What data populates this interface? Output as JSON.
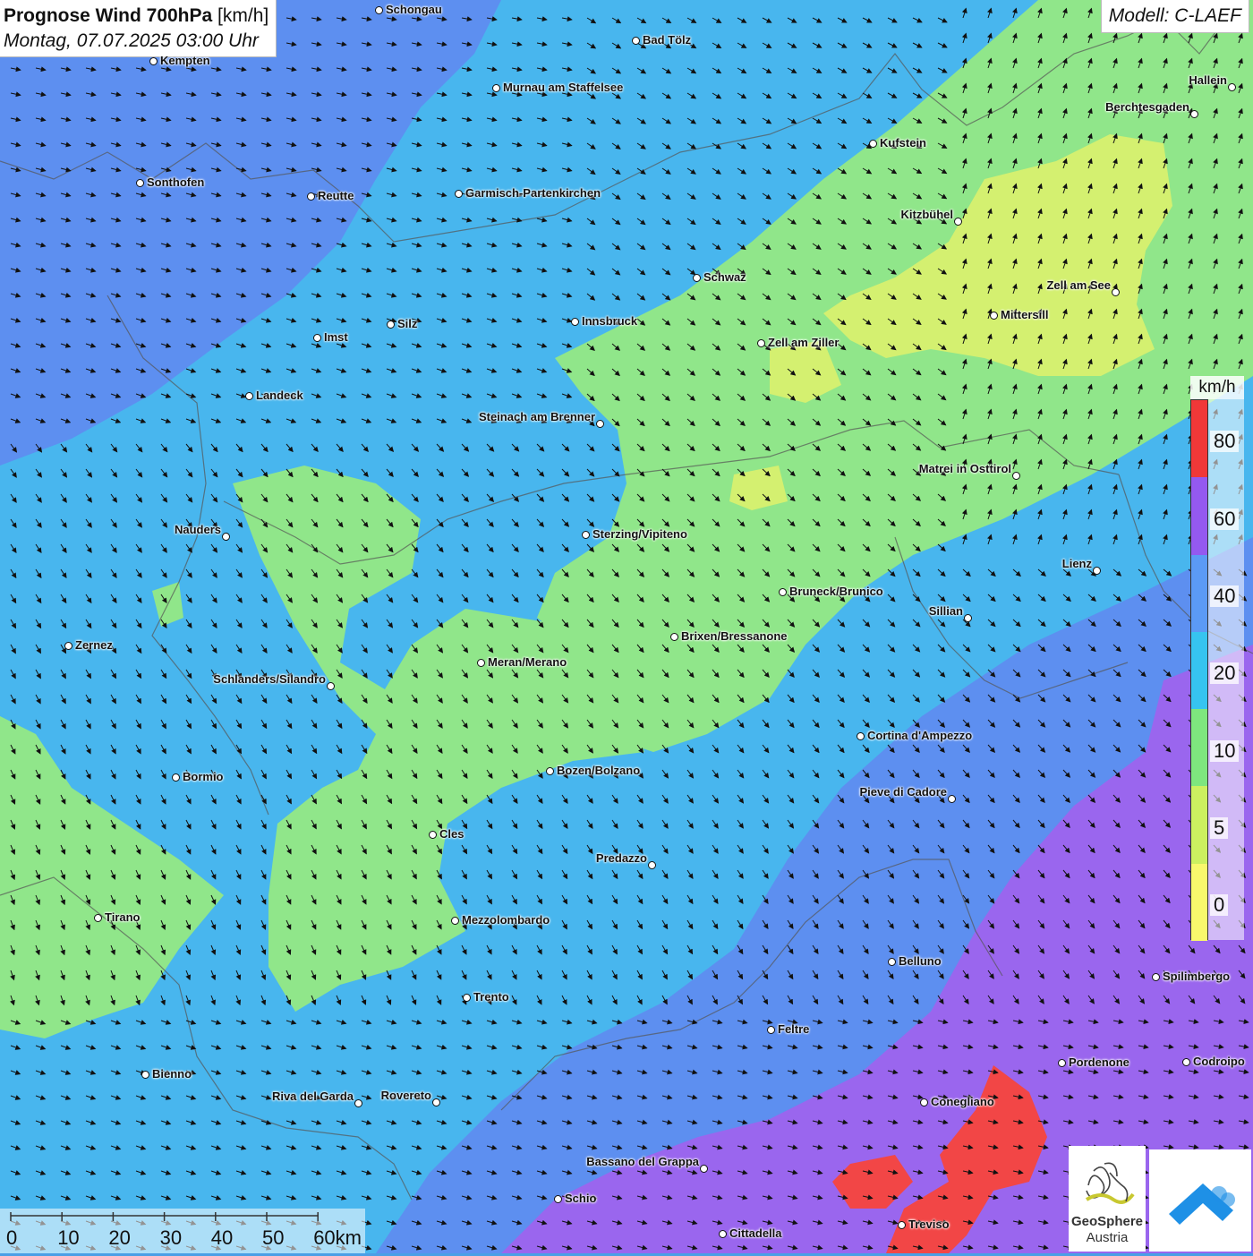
{
  "header": {
    "title_bold": "Prognose Wind 700hPa",
    "title_unit": "[km/h]",
    "subtitle": "Montag, 07.07.2025 03:00 Uhr"
  },
  "model": {
    "label": "Modell: C-LAEF"
  },
  "legend": {
    "unit": "km/h",
    "bands": [
      {
        "label": "80",
        "color": "#f03838"
      },
      {
        "label": "60",
        "color": "#9459f0"
      },
      {
        "label": "40",
        "color": "#5b9af5"
      },
      {
        "label": "20",
        "color": "#36c4f0"
      },
      {
        "label": "10",
        "color": "#7ee67e"
      },
      {
        "label": "5",
        "color": "#ccf060"
      },
      {
        "label": "0",
        "color": "#f8f86c"
      }
    ]
  },
  "scale_bar": {
    "labels": [
      "0",
      "10",
      "20",
      "30",
      "40",
      "50",
      "60km"
    ]
  },
  "logos": {
    "geosphere_line1": "GeoSphere",
    "geosphere_line2": "Austria"
  },
  "colors": {
    "purple_wind": "#9a66ee",
    "blue_wind": "#5d8ff0",
    "cyan_wind": "#48b6ee",
    "green_wind": "#90e68a",
    "yellowgreen_wind": "#d4f070",
    "red_wind": "#f24646"
  },
  "cities": [
    {
      "name": "Schongau"
    },
    {
      "name": "Bad Tölz"
    },
    {
      "name": "Kempten"
    },
    {
      "name": "Murnau am Staffelsee"
    },
    {
      "name": "Hallein"
    },
    {
      "name": "Berchtesgaden"
    },
    {
      "name": "Kufstein"
    },
    {
      "name": "Sonthofen"
    },
    {
      "name": "Reutte"
    },
    {
      "name": "Garmisch-Partenkirchen"
    },
    {
      "name": "Kitzbühel"
    },
    {
      "name": "Schwaz"
    },
    {
      "name": "Zell am See"
    },
    {
      "name": "Mittersill"
    },
    {
      "name": "Innsbruck"
    },
    {
      "name": "Silz"
    },
    {
      "name": "Imst"
    },
    {
      "name": "Zell am Ziller"
    },
    {
      "name": "Landeck"
    },
    {
      "name": "Steinach am Brenner"
    },
    {
      "name": "Matrei in Osttirol"
    },
    {
      "name": "Nauders"
    },
    {
      "name": "Sterzing/Vipiteno"
    },
    {
      "name": "Lienz"
    },
    {
      "name": "Bruneck/Brunico"
    },
    {
      "name": "Sillian"
    },
    {
      "name": "Brixen/Bressanone"
    },
    {
      "name": "Zernez"
    },
    {
      "name": "Meran/Merano"
    },
    {
      "name": "Schlanders/Silandro"
    },
    {
      "name": "Cortina d'Ampezzo"
    },
    {
      "name": "Bozen/Bolzano"
    },
    {
      "name": "Bormio"
    },
    {
      "name": "Pieve di Cadore"
    },
    {
      "name": "Cles"
    },
    {
      "name": "Predazzo"
    },
    {
      "name": "Tirano"
    },
    {
      "name": "Mezzolombardo"
    },
    {
      "name": "Belluno"
    },
    {
      "name": "Spilimbergo"
    },
    {
      "name": "Trento"
    },
    {
      "name": "Feltre"
    },
    {
      "name": "Pordenone"
    },
    {
      "name": "Codroipo"
    },
    {
      "name": "Bienno"
    },
    {
      "name": "Riva del Garda"
    },
    {
      "name": "Rovereto"
    },
    {
      "name": "Conegliano"
    },
    {
      "name": "Bassano del Grappa"
    },
    {
      "name": "Schio"
    },
    {
      "name": "Treviso"
    },
    {
      "name": "Cittadella"
    }
  ]
}
